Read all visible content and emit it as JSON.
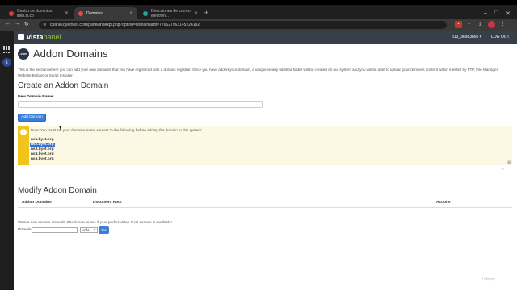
{
  "browser": {
    "tabs": [
      {
        "label": "Centro de dominios intel.si.co",
        "fav_color": "#d04040",
        "active": false
      },
      {
        "label": "Domains",
        "fav_color": "#e34b4b",
        "active": true
      },
      {
        "label": "Direcciones de correo electrón...",
        "fav_color": "#2aa198",
        "active": false
      }
    ],
    "new_tab": "+",
    "url": "cpanel.byethost.com/panel/indexpl.php?option=domains&ttt=776627963145224192",
    "window_controls": [
      "–",
      "□",
      "✕"
    ]
  },
  "header": {
    "logo_text_a": "vista",
    "logo_text_b": "panel",
    "user": "b13_36983896 ▾",
    "logout": "LOG OUT"
  },
  "page": {
    "icon_text": ".com",
    "title": "Addon Domains",
    "intro": "This is the section where you can add your own domains that you have registered with a domain registrar. Once you have added your domain, a unique clearly labelled folder will be created on our system and you will be able to upload your domains content within it either by FTP, File Manager, Website Builder or Script Installer.",
    "create_heading": "Create an Addon Domain",
    "new_domain_label": "New Domain Name:",
    "add_button": "Add Domain",
    "note_text": "Note: You must set your domains name servers to the following before adding the domain to this system:",
    "nameservers": [
      "ns1.byet.org",
      "ns2.byet.org",
      "ns3.byet.org",
      "ns4.byet.org",
      "ns5.byet.org"
    ],
    "selected_ns_index": 1,
    "modify_heading": "Modify Addon Domain",
    "table_headers": {
      "addon": "Addon Domains",
      "docroot": "Document Root",
      "actions": "Actions"
    },
    "avail_text": "Want a new domain instead? Check now to see if your preferred top-level domain is available!",
    "domain_label": "Domain:",
    "tld_value": ".info",
    "go_button": "Go"
  },
  "overlay": {
    "watermark": "Udemy"
  }
}
